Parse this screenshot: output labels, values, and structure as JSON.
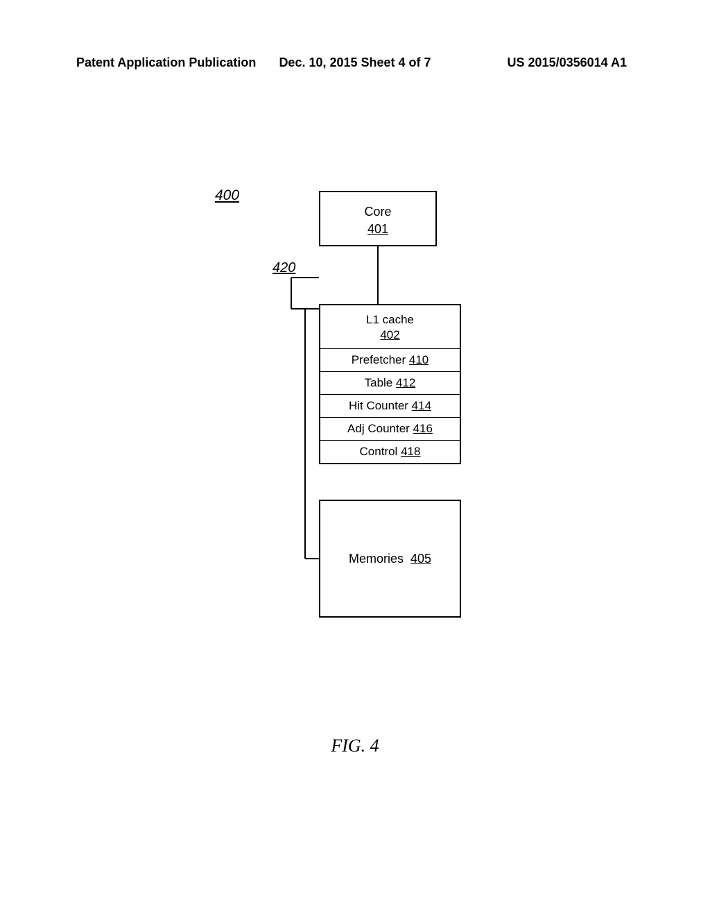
{
  "header": {
    "left": "Patent Application Publication",
    "center": "Dec. 10, 2015  Sheet 4 of 7",
    "right": "US 2015/0356014 A1"
  },
  "labels": {
    "fig400": "400",
    "fig420": "420"
  },
  "core": {
    "title": "Core",
    "ref": "401"
  },
  "stack": {
    "l1_title": "L1 cache",
    "l1_ref": "402",
    "prefetcher_label": "Prefetcher",
    "prefetcher_ref": "410",
    "table_label": "Table",
    "table_ref": "412",
    "hit_label": "Hit Counter",
    "hit_ref": "414",
    "adj_label": "Adj Counter",
    "adj_ref": "416",
    "control_label": "Control",
    "control_ref": "418"
  },
  "memories": {
    "label": "Memories",
    "ref": "405"
  },
  "caption": "FIG. 4"
}
